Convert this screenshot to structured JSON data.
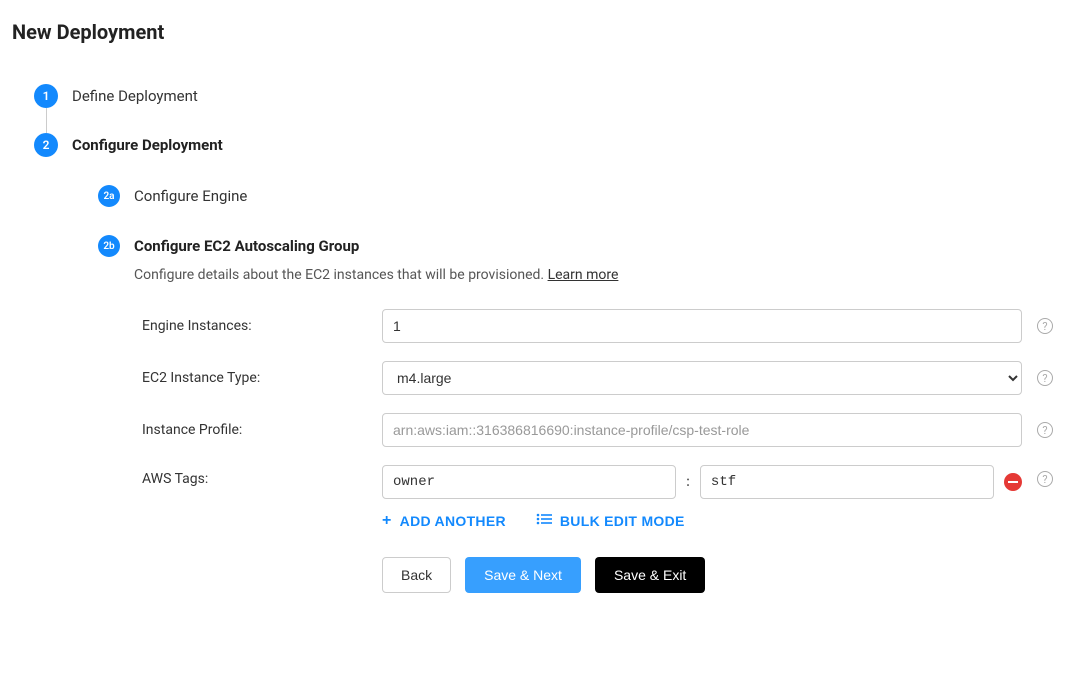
{
  "page": {
    "title": "New Deployment"
  },
  "steps": {
    "s1": {
      "badge": "1",
      "label": "Define Deployment"
    },
    "s2": {
      "badge": "2",
      "label": "Configure Deployment"
    }
  },
  "substeps": {
    "a": {
      "badge": "2a",
      "label": "Configure Engine"
    },
    "b": {
      "badge": "2b",
      "label": "Configure EC2 Autoscaling Group",
      "desc_text": "Configure details about the EC2 instances that will be provisioned. ",
      "learn_more": "Learn more"
    }
  },
  "form": {
    "engine_instances": {
      "label": "Engine Instances:",
      "value": "1"
    },
    "ec2_type": {
      "label": "EC2 Instance Type:",
      "value": "m4.large"
    },
    "instance_profile": {
      "label": "Instance Profile:",
      "placeholder": "arn:aws:iam::316386816690:instance-profile/csp-test-role"
    },
    "aws_tags": {
      "label": "AWS Tags:",
      "key": "owner",
      "sep": ":",
      "value": "stf",
      "add_another": "ADD ANOTHER",
      "bulk_edit": "BULK EDIT MODE"
    }
  },
  "buttons": {
    "back": "Back",
    "save_next": "Save & Next",
    "save_exit": "Save & Exit"
  }
}
